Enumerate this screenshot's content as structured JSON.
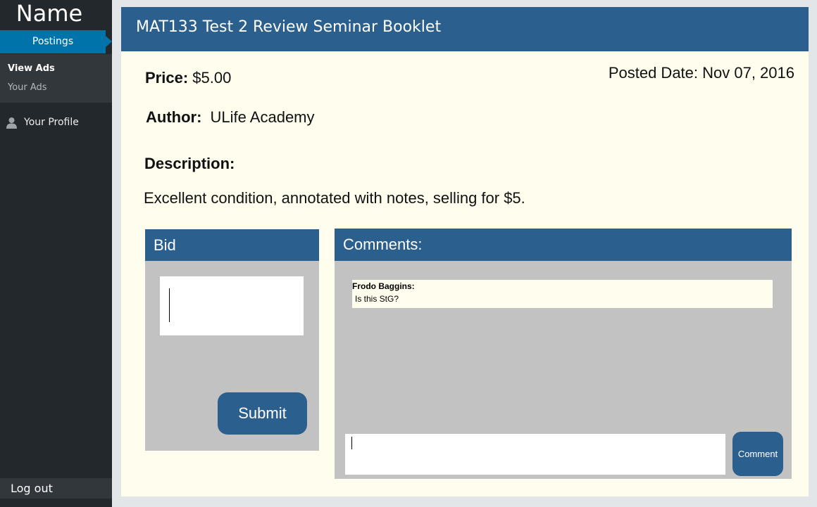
{
  "sidebar": {
    "brand": "Name",
    "nav_postings": "Postings",
    "submenu": {
      "view_ads": "View Ads",
      "your_ads": "Your Ads"
    },
    "profile_label": "Your Profile",
    "profile_icon": "user-icon",
    "logout_label": "Log out"
  },
  "listing": {
    "title": "MAT133 Test 2 Review Seminar Booklet",
    "price_label": "Price:",
    "price_value": "$5.00",
    "posted_date": "Posted Date: Nov 07, 2016",
    "author_label": "Author:",
    "author_value": "ULife Academy",
    "description_label": "Description:",
    "description_text": "Excellent condition, annotated with notes, selling for $5."
  },
  "bid": {
    "header": "Bid",
    "input_value": "",
    "submit_label": "Submit"
  },
  "comments": {
    "header": "Comments:",
    "items": [
      {
        "author": "Frodo Baggins:",
        "text": "Is this StG?"
      }
    ],
    "input_value": "",
    "button_label": "Comment"
  },
  "colors": {
    "sidebar_bg": "#23282d",
    "active_nav": "#0073aa",
    "header_blue": "#2b5f8e",
    "card_bg": "#fffdee",
    "panel_gray": "#c2c2c2"
  }
}
